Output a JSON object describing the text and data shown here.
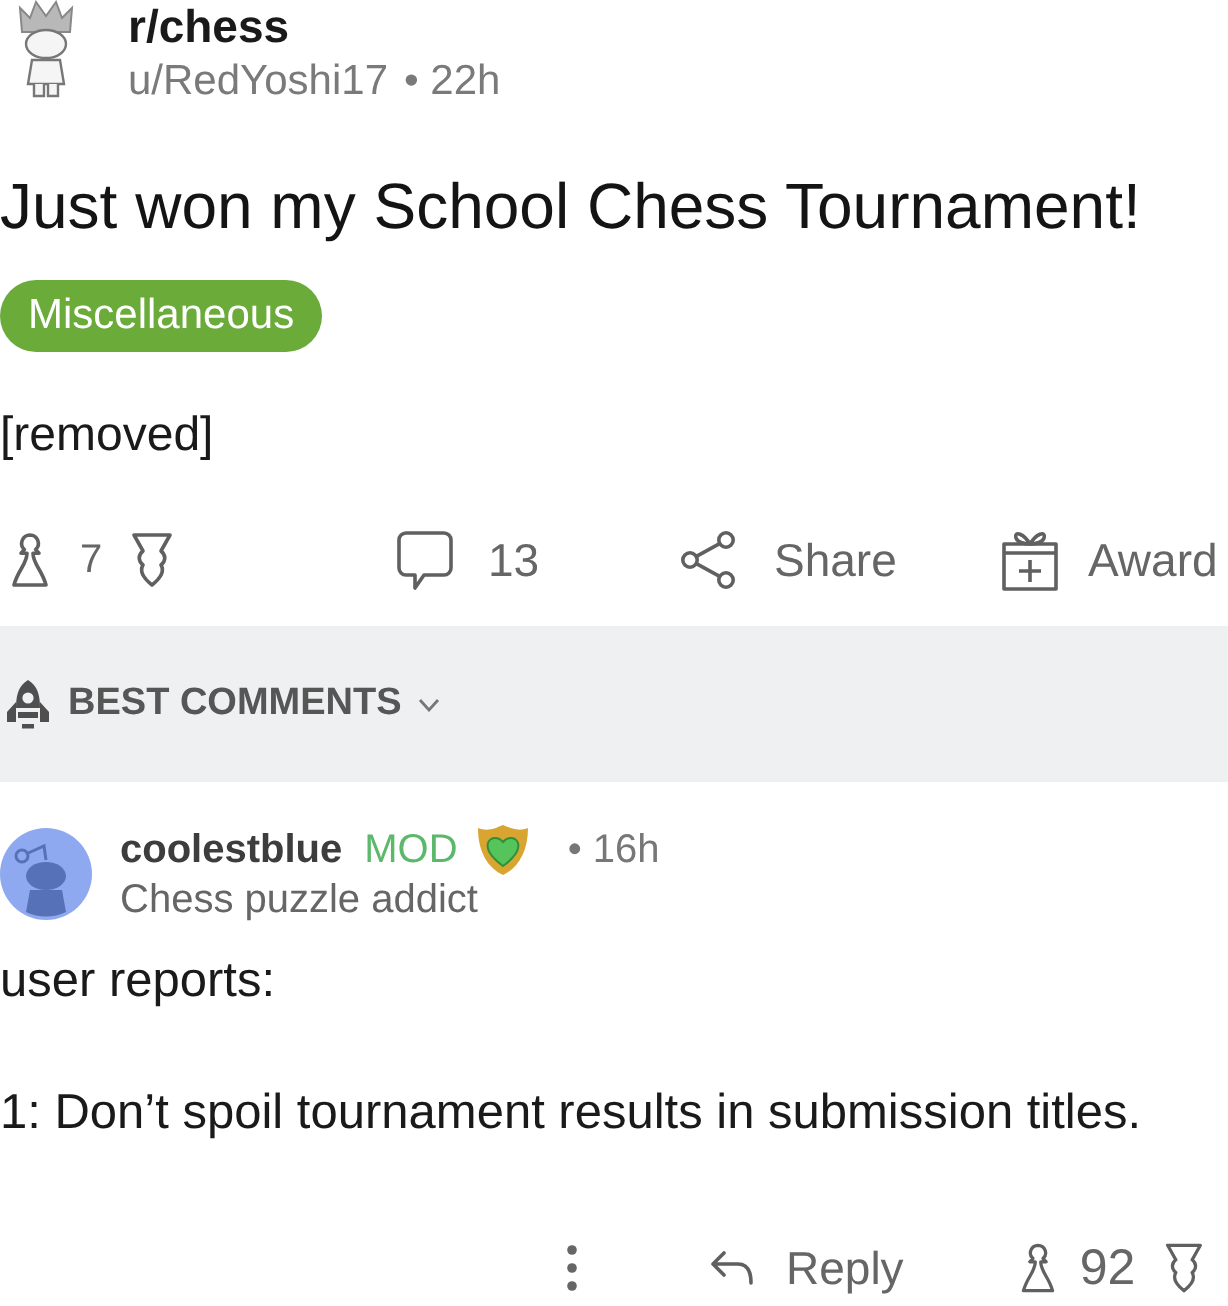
{
  "post": {
    "subreddit": "r/chess",
    "author": "u/RedYoshi17",
    "age": "• 22h",
    "title": "Just won my School Chess Tournament!",
    "flair": "Miscellaneous",
    "body": "[removed]"
  },
  "post_actions": {
    "score": "7",
    "comments": "13",
    "share": "Share",
    "award": "Award"
  },
  "sort": {
    "label": "BEST COMMENTS"
  },
  "comment": {
    "author": "coolestblue",
    "badge": "MOD",
    "age": "• 16h",
    "user_flair": "Chess puzzle addict",
    "body": [
      "user reports:",
      "1: Don’t spoil tournament results in submission titles."
    ],
    "reply": "Reply",
    "score": "92"
  }
}
